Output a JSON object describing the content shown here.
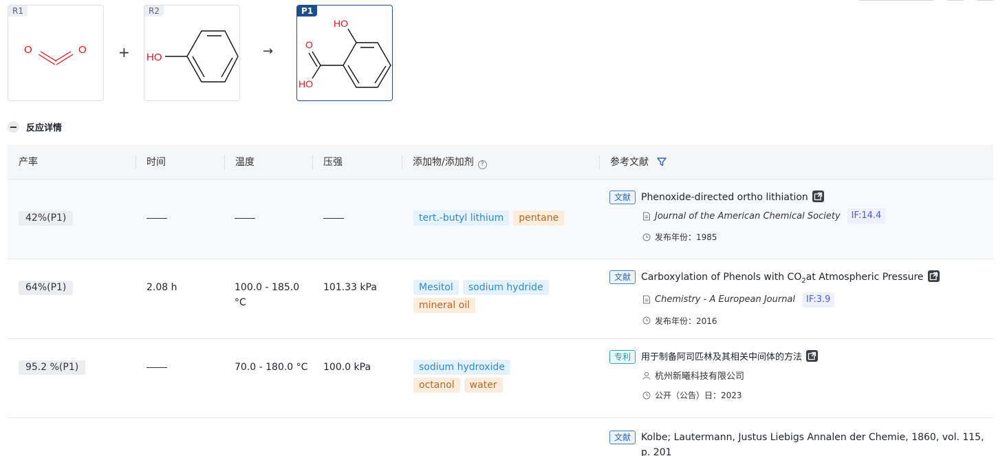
{
  "scheme": {
    "r1": {
      "tag": "R1",
      "atoms": [
        "O",
        "O"
      ]
    },
    "plus": "+",
    "r2": {
      "tag": "R2",
      "atoms": [
        "HO"
      ]
    },
    "arrow": "→",
    "p1": {
      "tag": "P1",
      "atoms": [
        "HO",
        "O",
        "HO"
      ]
    }
  },
  "section": {
    "title": "反应详情"
  },
  "table": {
    "headers": {
      "yield": "产率",
      "time": "时间",
      "temp": "温度",
      "pressure": "压强",
      "additives": "添加物/添加剂",
      "refs": "参考文献"
    },
    "rows": [
      {
        "yield": "42%(P1)",
        "time": "",
        "temp": "",
        "pressure": "",
        "additives": [
          {
            "label": "tert.-butyl lithium",
            "color": "blue"
          },
          {
            "label": "pentane",
            "color": "orange"
          }
        ],
        "ref": {
          "badge": "文献",
          "title": "Phenoxide-directed ortho lithiation",
          "journal": "Journal of the American Chemical Society",
          "if": "IF:14.4",
          "year_label": "发布年份：1985"
        }
      },
      {
        "yield": "64%(P1)",
        "time": "2.08 h",
        "temp": "100.0 - 185.0 °C",
        "pressure": "101.33 kPa",
        "additives": [
          {
            "label": "Mesitol",
            "color": "blue"
          },
          {
            "label": "sodium hydride",
            "color": "blue"
          },
          {
            "label": "mineral oil",
            "color": "orange"
          }
        ],
        "ref": {
          "badge": "文献",
          "title_a": "Carboxylation of Phenols with CO",
          "title_sub": "2",
          "title_b": "at Atmospheric Pressure",
          "journal": "Chemistry - A European Journal",
          "if": "IF:3.9",
          "year_label": "发布年份：2016"
        }
      },
      {
        "yield": "95.2 %(P1)",
        "time": "",
        "temp": "70.0 - 180.0 °C",
        "pressure": "100.0 kPa",
        "additives": [
          {
            "label": "sodium hydroxide",
            "color": "blue"
          },
          {
            "label": "octanol",
            "color": "orange"
          },
          {
            "label": "water",
            "color": "orange"
          }
        ],
        "ref": {
          "badge": "专利",
          "title": "用于制备阿司匹林及其相关中间体的方法",
          "assignee": "杭州新曦科技有限公司",
          "year_label": "公开（公告）日：2023"
        }
      },
      {
        "ref": {
          "badge": "文献",
          "title": "Kolbe; Lautermann, Justus Liebigs Annalen der Chemie, 1860, vol. 115, p. 201"
        }
      }
    ]
  },
  "colors": {
    "accent": "#1f4e8c",
    "atom_red": "#e8101a",
    "chip_blue": "#2b8ad0",
    "chip_orange": "#b5682a"
  }
}
